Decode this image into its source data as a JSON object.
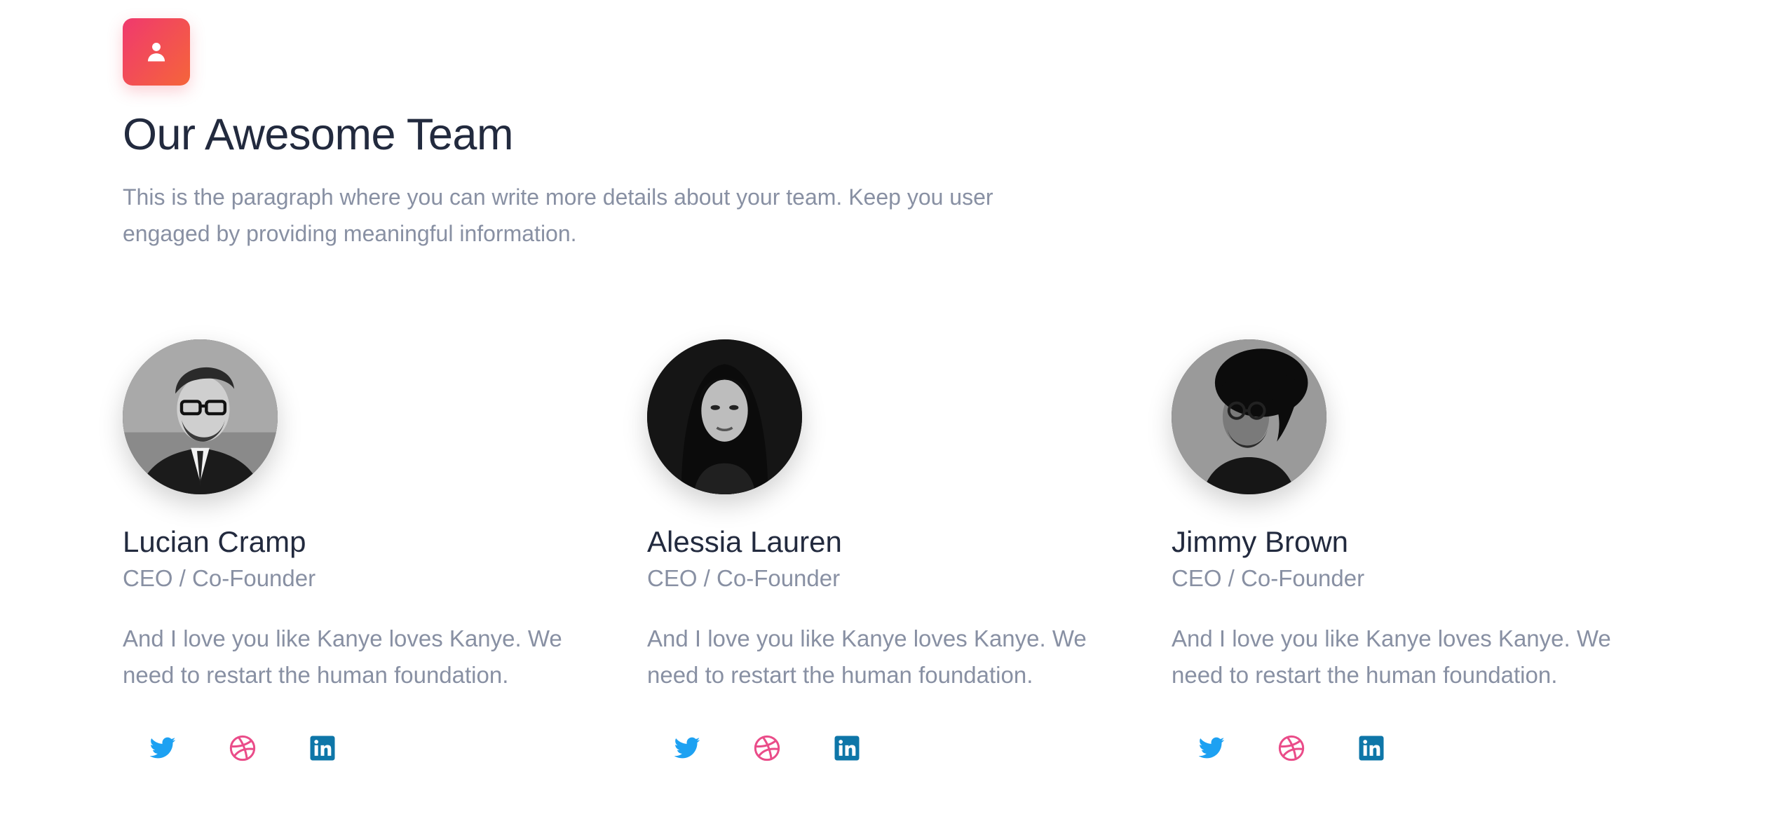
{
  "header": {
    "icon": "user-icon",
    "title": "Our Awesome Team",
    "intro": "This is the paragraph where you can write more details about your team. Keep you user engaged by providing meaningful information."
  },
  "colors": {
    "accent_gradient_start": "#f0396e",
    "accent_gradient_end": "#f5653a",
    "twitter": "#1da1f2",
    "dribbble": "#ea4c89",
    "linkedin": "#0e76a8",
    "heading": "#222a3e",
    "muted": "#8890a3"
  },
  "members": [
    {
      "name": "Lucian Cramp",
      "role": "CEO / Co-Founder",
      "bio": "And I love you like Kanye loves Kanye. We need to restart the human foundation.",
      "avatar": "portrait-man-glasses",
      "socials": [
        "twitter-icon",
        "dribbble-icon",
        "linkedin-icon"
      ]
    },
    {
      "name": "Alessia Lauren",
      "role": "CEO / Co-Founder",
      "bio": "And I love you like Kanye loves Kanye. We need to restart the human foundation.",
      "avatar": "portrait-woman",
      "socials": [
        "twitter-icon",
        "dribbble-icon",
        "linkedin-icon"
      ]
    },
    {
      "name": "Jimmy Brown",
      "role": "CEO / Co-Founder",
      "bio": "And I love you like Kanye loves Kanye. We need to restart the human foundation.",
      "avatar": "portrait-man-hat",
      "socials": [
        "twitter-icon",
        "dribbble-icon",
        "linkedin-icon"
      ]
    }
  ]
}
